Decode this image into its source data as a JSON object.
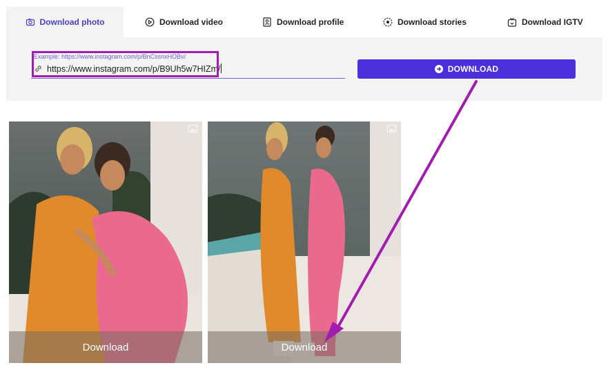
{
  "tabs": [
    {
      "label": "Download photo",
      "icon": "camera-icon",
      "active": true
    },
    {
      "label": "Download video",
      "icon": "play-circle-icon",
      "active": false
    },
    {
      "label": "Download profile",
      "icon": "profile-card-icon",
      "active": false
    },
    {
      "label": "Download stories",
      "icon": "stories-icon",
      "active": false
    },
    {
      "label": "Download IGTV",
      "icon": "tv-icon",
      "active": false
    }
  ],
  "search": {
    "placeholder": "Example: https://www.instagram.com/p/BnCssnxHOBv/",
    "value": "https://www.instagram.com/p/B9Uh5w7HIZm/"
  },
  "download_button": {
    "label": "DOWNLOAD",
    "icon": "arrow-right-circle-icon"
  },
  "results": [
    {
      "download_label": "Download",
      "type_icon": "image-icon"
    },
    {
      "download_label": "Download",
      "type_icon": "image-icon"
    }
  ],
  "colors": {
    "accent": "#4a2fdb",
    "tab_active": "#4a3fc9",
    "annotation": "#a21caf",
    "panel_bg": "#f3f3f4"
  }
}
